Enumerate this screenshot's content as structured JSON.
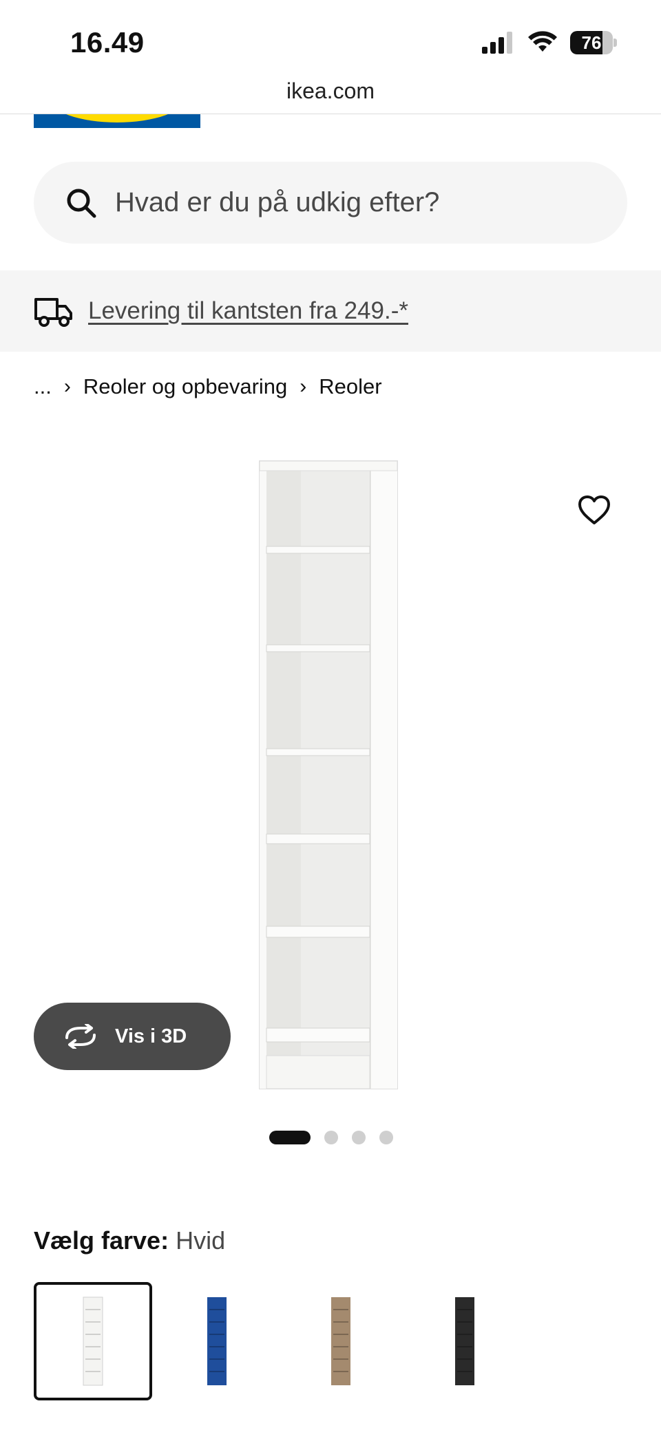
{
  "status_bar": {
    "time": "16.49",
    "battery_level": "76",
    "battery_fraction": 0.76,
    "icons": [
      "cellular-signal-icon",
      "wifi-icon",
      "battery-icon"
    ]
  },
  "browser": {
    "url": "ikea.com"
  },
  "search": {
    "placeholder": "Hvad er du på udkig efter?",
    "icon": "search-icon"
  },
  "delivery": {
    "icon": "truck-icon",
    "link_text": "Levering til kantsten fra 249.-*"
  },
  "breadcrumb": {
    "ellipsis": "...",
    "separator": "›",
    "items": [
      "Reoler og opbevaring",
      "Reoler"
    ]
  },
  "product_image": {
    "wishlist_icon": "heart-icon",
    "view_3d_label": "Vis i 3D",
    "view_3d_icon": "rotate-3d-icon",
    "carousel": {
      "total": 4,
      "active_index": 0
    }
  },
  "color_picker": {
    "label": "Vælg farve:",
    "selected_value": "Hvid",
    "options": [
      {
        "color": "#f4f4f2",
        "selected": true
      },
      {
        "color": "#1f4e9c",
        "selected": false
      },
      {
        "color": "#a48a6e",
        "selected": false
      },
      {
        "color": "#2a2a2a",
        "selected": false
      }
    ]
  },
  "colors": {
    "ikea_blue": "#0058a3",
    "ikea_yellow": "#ffdb00",
    "surface_grey": "#f5f5f5",
    "button_dark": "#4a4a4a"
  }
}
